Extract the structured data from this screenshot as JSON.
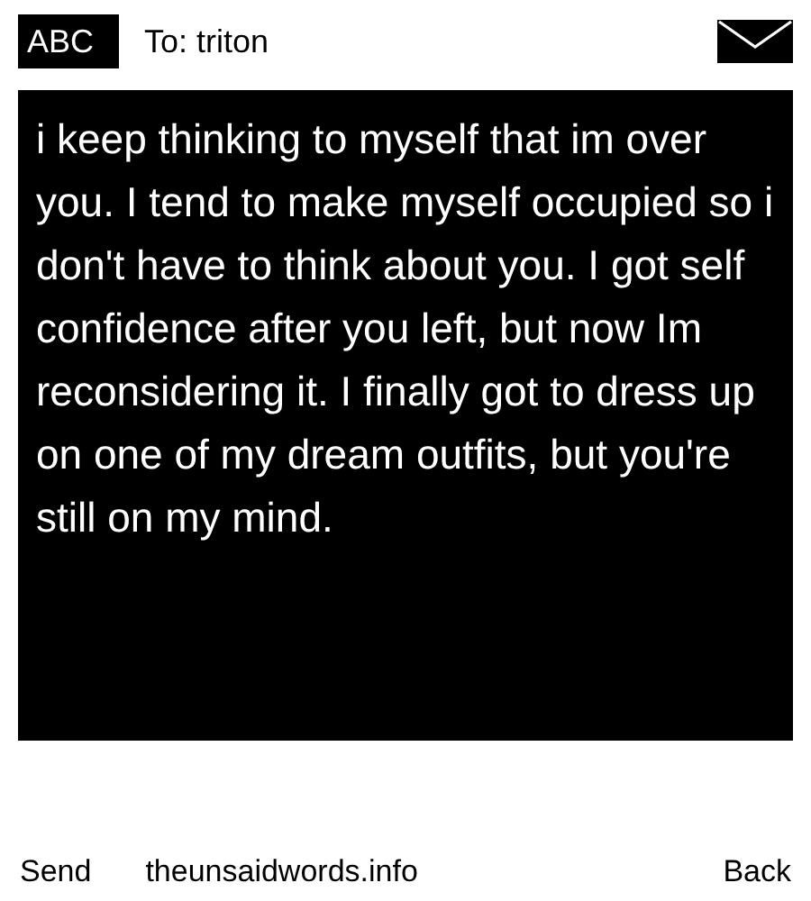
{
  "header": {
    "badge": "ABC",
    "recipient": "To: triton"
  },
  "message": "i keep thinking to myself that im over you. I tend to make myself occupied so i don't have to think about you. I got self confidence after you left, but now Im reconsidering it. I finally got to dress up on one of my dream outfits, but you're still on my mind.",
  "footer": {
    "send": "Send",
    "site": "theunsaidwords.info",
    "back": "Back"
  }
}
